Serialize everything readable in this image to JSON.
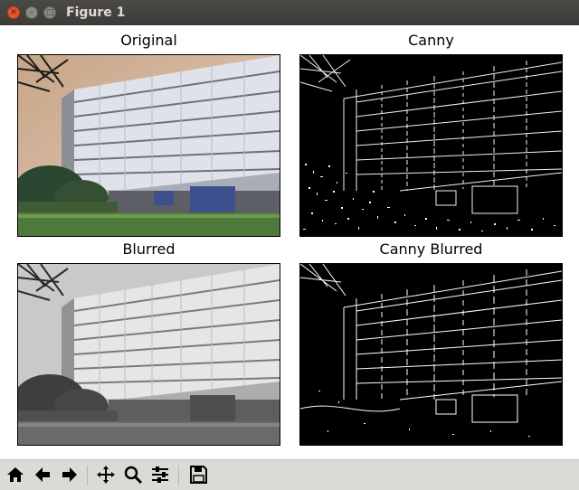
{
  "window": {
    "title": "Figure 1"
  },
  "subplots": [
    {
      "title": "Original"
    },
    {
      "title": "Canny"
    },
    {
      "title": "Blurred"
    },
    {
      "title": "Canny Blurred"
    }
  ],
  "toolbar": {
    "icons": [
      "home-icon",
      "back-arrow-icon",
      "forward-arrow-icon",
      "pan-icon",
      "zoom-icon",
      "configure-subplots-icon",
      "save-icon"
    ]
  }
}
